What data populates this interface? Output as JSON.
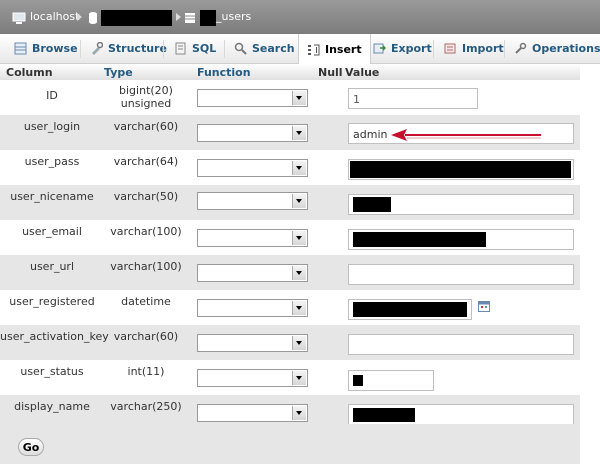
{
  "breadcrumb": {
    "server": "localhost",
    "table_suffix": "_users"
  },
  "tabs": [
    "Browse",
    "Structure",
    "SQL",
    "Search",
    "Insert",
    "Export",
    "Import",
    "Operations"
  ],
  "active_tab": "Insert",
  "headers": {
    "column": "Column",
    "type": "Type",
    "function": "Function",
    "null": "Null",
    "value": "Value"
  },
  "rows": [
    {
      "name": "ID",
      "type": "bigint(20) unsigned",
      "value": "1"
    },
    {
      "name": "user_login",
      "type": "varchar(60)",
      "value": "admin"
    },
    {
      "name": "user_pass",
      "type": "varchar(64)",
      "value": ""
    },
    {
      "name": "user_nicename",
      "type": "varchar(50)",
      "value": ""
    },
    {
      "name": "user_email",
      "type": "varchar(100)",
      "value": ""
    },
    {
      "name": "user_url",
      "type": "varchar(100)",
      "value": ""
    },
    {
      "name": "user_registered",
      "type": "datetime",
      "value": ""
    },
    {
      "name": "user_activation_key",
      "type": "varchar(60)",
      "value": ""
    },
    {
      "name": "user_status",
      "type": "int(11)",
      "value": ""
    },
    {
      "name": "display_name",
      "type": "varchar(250)",
      "value": ""
    }
  ],
  "go_label": "Go",
  "colors": {
    "link": "#235a81",
    "arrow": "#c8102e",
    "redaction": "#000000"
  }
}
